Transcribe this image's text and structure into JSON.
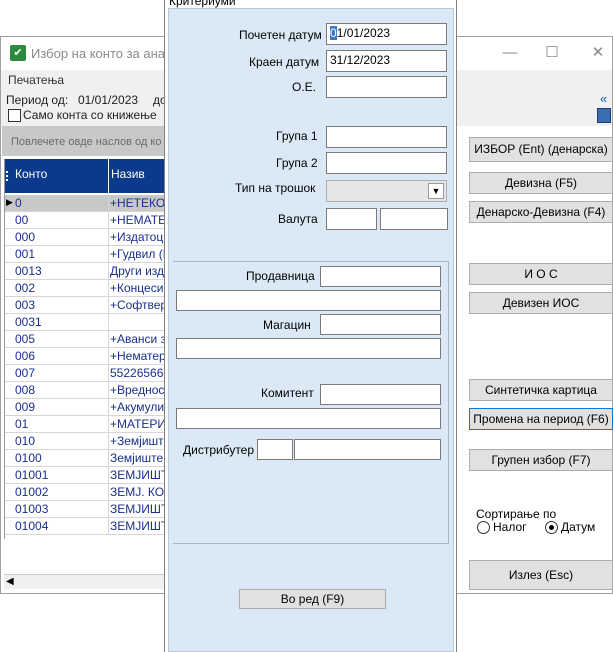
{
  "window": {
    "title": "Избор на конто за анали",
    "menu_print": "Печатења",
    "period_label": "Период од:",
    "period_from": "01/01/2023",
    "period_to_label": "до",
    "only_posted_label": "Само конта со книжење",
    "collapse_glyph": "«",
    "group_hint": "Повлечете овде наслов од ко",
    "printer_icon": "printer-icon"
  },
  "grid": {
    "columns": [
      "Конто",
      "Назив"
    ],
    "rows": [
      {
        "konto": "0",
        "naziv": "+НЕТЕКОВ"
      },
      {
        "konto": "00",
        "naziv": "+НЕМАТЕР"
      },
      {
        "konto": "000",
        "naziv": "+Издатоци"
      },
      {
        "konto": "001",
        "naziv": "+Гудвил (Го"
      },
      {
        "konto": "0013",
        "naziv": "Други изда"
      },
      {
        "konto": "002",
        "naziv": "+Концесии"
      },
      {
        "konto": "003",
        "naziv": "+Софтвер и"
      },
      {
        "konto": "0031",
        "naziv": ""
      },
      {
        "konto": "005",
        "naziv": "+Аванси за"
      },
      {
        "konto": "006",
        "naziv": "+Нематери"
      },
      {
        "konto": "007",
        "naziv": "552265662"
      },
      {
        "konto": "008",
        "naziv": "+Вредносн"
      },
      {
        "konto": "009",
        "naziv": "+Акумулир"
      },
      {
        "konto": "01",
        "naziv": "+МАТЕРИЈ"
      },
      {
        "konto": "010",
        "naziv": "+Земјишта"
      },
      {
        "konto": "0100",
        "naziv": "Земјиште"
      },
      {
        "konto": "01001",
        "naziv": "ЗЕМЈИШТЕ"
      },
      {
        "konto": "01002",
        "naziv": "ЗЕМЈ. КО К"
      },
      {
        "konto": "01003",
        "naziv": "ЗЕМЈИШТЕ"
      },
      {
        "konto": "01004",
        "naziv": "ЗЕМЈИШТЕ"
      }
    ]
  },
  "buttons": {
    "izbor": "ИЗБОР (Ent) (денарска)",
    "devizna": "Девизна (F5)",
    "denarsko_devizna": "Денарско-Девизна (F4)",
    "ios": "И О С",
    "deviza_ios": "Девизен ИОС",
    "sintetichka": "Синтетичка картица",
    "promena_period": "Промена на период (F6)",
    "grupen_izbor": "Групен избор (F7)",
    "izlez": "Излез (Esc)"
  },
  "sort": {
    "label": "Сортирање по",
    "options": [
      "Налог",
      "Датум"
    ],
    "selected": "Датум"
  },
  "dialog": {
    "title": "Критериуми",
    "start_date_label": "Почетен датум",
    "start_date_value": "01/01/2023",
    "end_date_label": "Краен датум",
    "end_date_value": "31/12/2023",
    "oe_label": "О.Е.",
    "group1_label": "Група 1",
    "group2_label": "Група 2",
    "cost_type_label": "Тип на трошок",
    "currency_label": "Валута",
    "store_label": "Продавница",
    "warehouse_label": "Магацин",
    "client_label": "Комитент",
    "distributor_label": "Дистрибутер",
    "ok_button": "Во ред  (F9)"
  }
}
